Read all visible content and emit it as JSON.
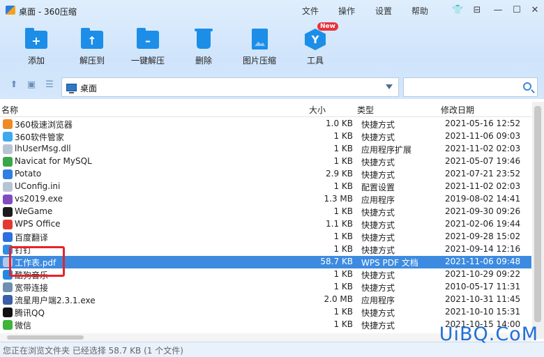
{
  "window": {
    "title": "桌面 - 360压缩"
  },
  "menu": [
    "文件",
    "操作",
    "设置",
    "帮助"
  ],
  "toolbar": {
    "add": "添加",
    "extract_to": "解压到",
    "one_click_extract": "一键解压",
    "delete": "删除",
    "image_compress": "图片压缩",
    "tools": "工具",
    "new_badge": "New"
  },
  "address": {
    "path": "桌面",
    "search_placeholder": ""
  },
  "columns": {
    "name": "名称",
    "size": "大小",
    "type": "类型",
    "modified": "修改日期"
  },
  "files": [
    {
      "name": "360极速浏览器",
      "size": "1.0 KB",
      "type": "快捷方式",
      "date": "2021-05-16 12:52",
      "color": "#f08a24"
    },
    {
      "name": "360软件管家",
      "size": "1 KB",
      "type": "快捷方式",
      "date": "2021-11-06 09:03",
      "color": "#3fa8f0"
    },
    {
      "name": "lhUserMsg.dll",
      "size": "1 KB",
      "type": "应用程序扩展",
      "date": "2021-11-02 02:03",
      "color": "#b8c4d4"
    },
    {
      "name": "Navicat for MySQL",
      "size": "1 KB",
      "type": "快捷方式",
      "date": "2021-05-07 19:46",
      "color": "#3aa64a"
    },
    {
      "name": "Potato",
      "size": "2.9 KB",
      "type": "快捷方式",
      "date": "2021-07-21 23:52",
      "color": "#2f7fe0"
    },
    {
      "name": "UConfig.ini",
      "size": "1 KB",
      "type": "配置设置",
      "date": "2021-11-02 02:03",
      "color": "#b8c4d4"
    },
    {
      "name": "vs2019.exe",
      "size": "1.3 MB",
      "type": "应用程序",
      "date": "2019-08-02 14:41",
      "color": "#7f4cc2"
    },
    {
      "name": "WeGame",
      "size": "1 KB",
      "type": "快捷方式",
      "date": "2021-09-30 09:26",
      "color": "#1c1c1c"
    },
    {
      "name": "WPS Office",
      "size": "1.1 KB",
      "type": "快捷方式",
      "date": "2021-02-06 19:44",
      "color": "#e23a2e"
    },
    {
      "name": "百度翻译",
      "size": "1 KB",
      "type": "快捷方式",
      "date": "2021-09-28 15:02",
      "color": "#2f6fe0"
    },
    {
      "name": "钉钉",
      "size": "1 KB",
      "type": "快捷方式",
      "date": "2021-09-14 12:16",
      "color": "#2f8ee8"
    },
    {
      "name": "工作表.pdf",
      "size": "58.7 KB",
      "type": "WPS PDF 文档",
      "date": "2021-11-06 09:48",
      "color": "#b9c6e8",
      "selected": true
    },
    {
      "name": "酷狗音乐",
      "size": "1 KB",
      "type": "快捷方式",
      "date": "2021-10-29 09:22",
      "color": "#1f8ae8"
    },
    {
      "name": "宽带连接",
      "size": "1 KB",
      "type": "快捷方式",
      "date": "2010-05-17 11:31",
      "color": "#6f8fb0"
    },
    {
      "name": "流星用户端2.3.1.exe",
      "size": "2.0 MB",
      "type": "应用程序",
      "date": "2021-10-31 11:45",
      "color": "#3a5fa8"
    },
    {
      "name": "腾讯QQ",
      "size": "1 KB",
      "type": "快捷方式",
      "date": "2021-10-10 15:31",
      "color": "#111111"
    },
    {
      "name": "微信",
      "size": "1 KB",
      "type": "快捷方式",
      "date": "2021-10-15 14:00",
      "color": "#3cb53a"
    }
  ],
  "status": {
    "text": "您正在浏览文件夹 已经选择 58.7 KB (1 个文件)"
  },
  "watermark": "UiBQ.CoM",
  "colors": {
    "accent": "#1c8ee8",
    "selection": "#3c8be0",
    "highlight_box": "#e8222a"
  }
}
